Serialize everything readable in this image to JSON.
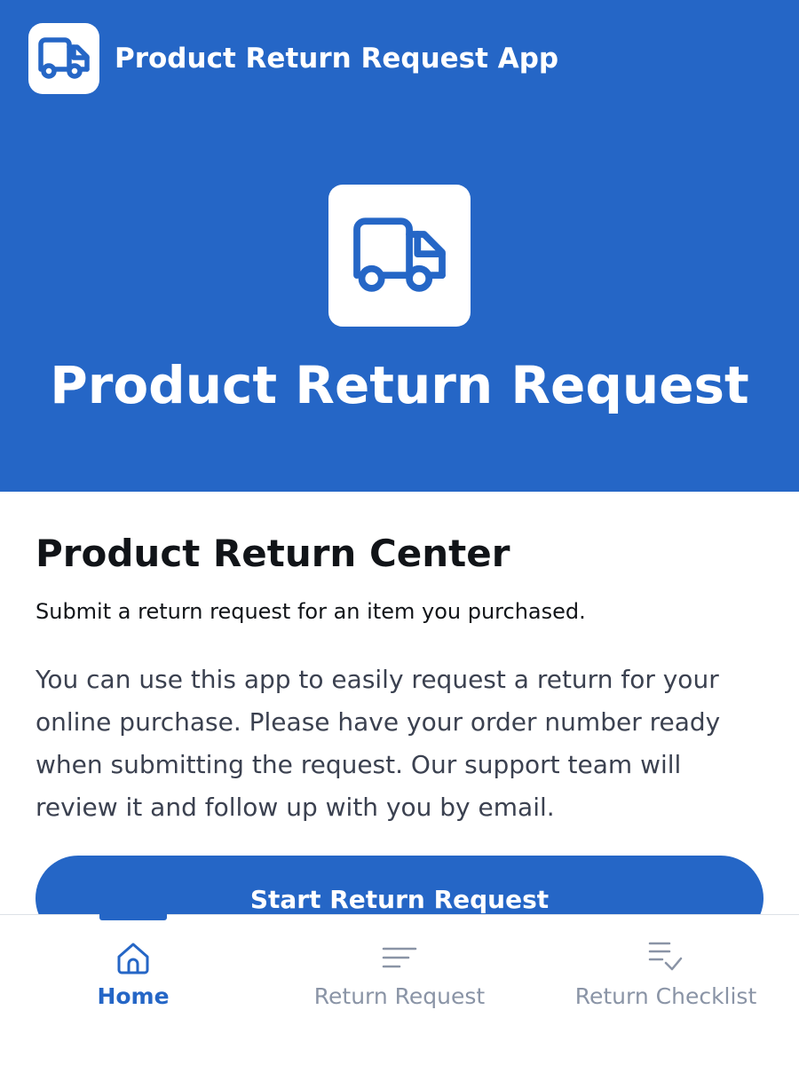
{
  "app_bar": {
    "title": "Product Return Request App",
    "icon": "truck-icon"
  },
  "hero": {
    "icon": "truck-icon",
    "title": "Product Return Request"
  },
  "main": {
    "heading": "Product Return Center",
    "subtitle": "Submit a return request for an item you purchased.",
    "body": "You can use this app to easily request a return for your online purchase. Please have your order number ready when submitting the request. Our support team will review it and follow up with you by email.",
    "cta_label": "Start Return Request"
  },
  "bottom_nav": {
    "items": [
      {
        "label": "Home",
        "icon": "home-icon",
        "active": true
      },
      {
        "label": "Return Request",
        "icon": "list-icon",
        "active": false
      },
      {
        "label": "Return Checklist",
        "icon": "checklist-icon",
        "active": false
      }
    ]
  },
  "colors": {
    "primary": "#2566c6",
    "text_dark": "#111418",
    "text_body": "#3b4150",
    "nav_inactive": "#8a94a6"
  }
}
